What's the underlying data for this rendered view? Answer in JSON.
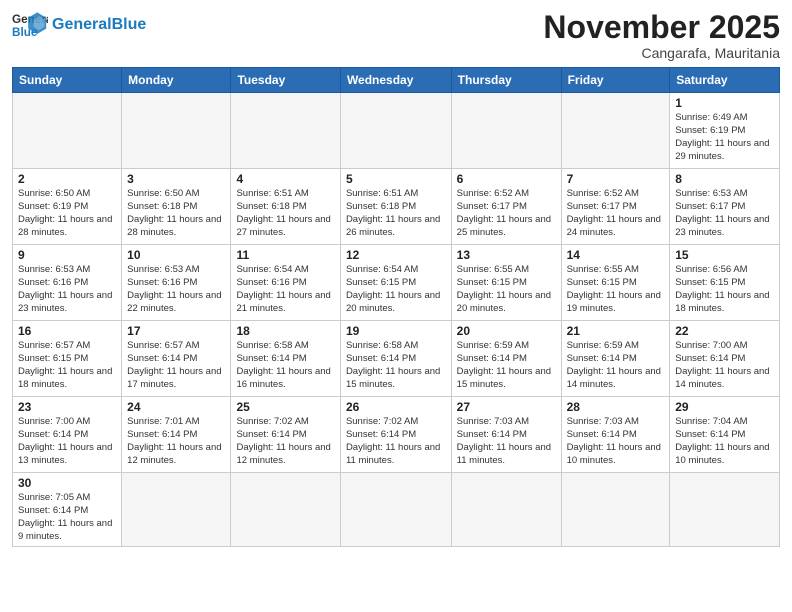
{
  "logo": {
    "general": "General",
    "blue": "Blue"
  },
  "title": "November 2025",
  "subtitle": "Cangarafa, Mauritania",
  "header_days": [
    "Sunday",
    "Monday",
    "Tuesday",
    "Wednesday",
    "Thursday",
    "Friday",
    "Saturday"
  ],
  "weeks": [
    [
      {
        "day": "",
        "info": ""
      },
      {
        "day": "",
        "info": ""
      },
      {
        "day": "",
        "info": ""
      },
      {
        "day": "",
        "info": ""
      },
      {
        "day": "",
        "info": ""
      },
      {
        "day": "",
        "info": ""
      },
      {
        "day": "1",
        "info": "Sunrise: 6:49 AM\nSunset: 6:19 PM\nDaylight: 11 hours\nand 29 minutes."
      }
    ],
    [
      {
        "day": "2",
        "info": "Sunrise: 6:50 AM\nSunset: 6:19 PM\nDaylight: 11 hours\nand 28 minutes."
      },
      {
        "day": "3",
        "info": "Sunrise: 6:50 AM\nSunset: 6:18 PM\nDaylight: 11 hours\nand 28 minutes."
      },
      {
        "day": "4",
        "info": "Sunrise: 6:51 AM\nSunset: 6:18 PM\nDaylight: 11 hours\nand 27 minutes."
      },
      {
        "day": "5",
        "info": "Sunrise: 6:51 AM\nSunset: 6:18 PM\nDaylight: 11 hours\nand 26 minutes."
      },
      {
        "day": "6",
        "info": "Sunrise: 6:52 AM\nSunset: 6:17 PM\nDaylight: 11 hours\nand 25 minutes."
      },
      {
        "day": "7",
        "info": "Sunrise: 6:52 AM\nSunset: 6:17 PM\nDaylight: 11 hours\nand 24 minutes."
      },
      {
        "day": "8",
        "info": "Sunrise: 6:53 AM\nSunset: 6:17 PM\nDaylight: 11 hours\nand 23 minutes."
      }
    ],
    [
      {
        "day": "9",
        "info": "Sunrise: 6:53 AM\nSunset: 6:16 PM\nDaylight: 11 hours\nand 23 minutes."
      },
      {
        "day": "10",
        "info": "Sunrise: 6:53 AM\nSunset: 6:16 PM\nDaylight: 11 hours\nand 22 minutes."
      },
      {
        "day": "11",
        "info": "Sunrise: 6:54 AM\nSunset: 6:16 PM\nDaylight: 11 hours\nand 21 minutes."
      },
      {
        "day": "12",
        "info": "Sunrise: 6:54 AM\nSunset: 6:15 PM\nDaylight: 11 hours\nand 20 minutes."
      },
      {
        "day": "13",
        "info": "Sunrise: 6:55 AM\nSunset: 6:15 PM\nDaylight: 11 hours\nand 20 minutes."
      },
      {
        "day": "14",
        "info": "Sunrise: 6:55 AM\nSunset: 6:15 PM\nDaylight: 11 hours\nand 19 minutes."
      },
      {
        "day": "15",
        "info": "Sunrise: 6:56 AM\nSunset: 6:15 PM\nDaylight: 11 hours\nand 18 minutes."
      }
    ],
    [
      {
        "day": "16",
        "info": "Sunrise: 6:57 AM\nSunset: 6:15 PM\nDaylight: 11 hours\nand 18 minutes."
      },
      {
        "day": "17",
        "info": "Sunrise: 6:57 AM\nSunset: 6:14 PM\nDaylight: 11 hours\nand 17 minutes."
      },
      {
        "day": "18",
        "info": "Sunrise: 6:58 AM\nSunset: 6:14 PM\nDaylight: 11 hours\nand 16 minutes."
      },
      {
        "day": "19",
        "info": "Sunrise: 6:58 AM\nSunset: 6:14 PM\nDaylight: 11 hours\nand 15 minutes."
      },
      {
        "day": "20",
        "info": "Sunrise: 6:59 AM\nSunset: 6:14 PM\nDaylight: 11 hours\nand 15 minutes."
      },
      {
        "day": "21",
        "info": "Sunrise: 6:59 AM\nSunset: 6:14 PM\nDaylight: 11 hours\nand 14 minutes."
      },
      {
        "day": "22",
        "info": "Sunrise: 7:00 AM\nSunset: 6:14 PM\nDaylight: 11 hours\nand 14 minutes."
      }
    ],
    [
      {
        "day": "23",
        "info": "Sunrise: 7:00 AM\nSunset: 6:14 PM\nDaylight: 11 hours\nand 13 minutes."
      },
      {
        "day": "24",
        "info": "Sunrise: 7:01 AM\nSunset: 6:14 PM\nDaylight: 11 hours\nand 12 minutes."
      },
      {
        "day": "25",
        "info": "Sunrise: 7:02 AM\nSunset: 6:14 PM\nDaylight: 11 hours\nand 12 minutes."
      },
      {
        "day": "26",
        "info": "Sunrise: 7:02 AM\nSunset: 6:14 PM\nDaylight: 11 hours\nand 11 minutes."
      },
      {
        "day": "27",
        "info": "Sunrise: 7:03 AM\nSunset: 6:14 PM\nDaylight: 11 hours\nand 11 minutes."
      },
      {
        "day": "28",
        "info": "Sunrise: 7:03 AM\nSunset: 6:14 PM\nDaylight: 11 hours\nand 10 minutes."
      },
      {
        "day": "29",
        "info": "Sunrise: 7:04 AM\nSunset: 6:14 PM\nDaylight: 11 hours\nand 10 minutes."
      }
    ],
    [
      {
        "day": "30",
        "info": "Sunrise: 7:05 AM\nSunset: 6:14 PM\nDaylight: 11 hours\nand 9 minutes."
      },
      {
        "day": "",
        "info": ""
      },
      {
        "day": "",
        "info": ""
      },
      {
        "day": "",
        "info": ""
      },
      {
        "day": "",
        "info": ""
      },
      {
        "day": "",
        "info": ""
      },
      {
        "day": "",
        "info": ""
      }
    ]
  ]
}
